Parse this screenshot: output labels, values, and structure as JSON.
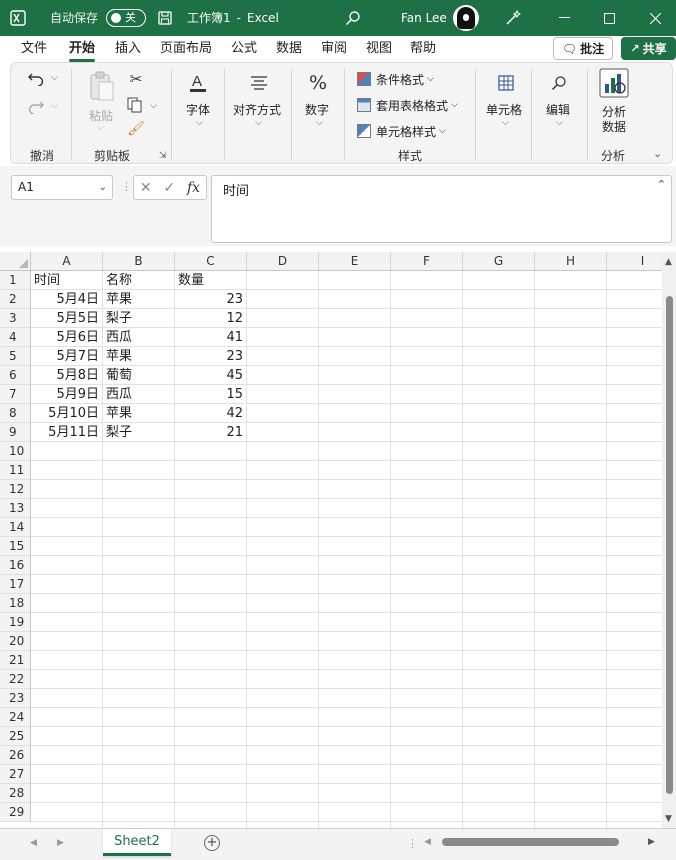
{
  "titlebar": {
    "autosave_label": "自动保存",
    "autosave_state": "关",
    "doc_title": "工作簿1",
    "separator": "-",
    "app_name": "Excel",
    "user_name": "Fan Lee"
  },
  "menu": {
    "items": [
      "文件",
      "开始",
      "插入",
      "页面布局",
      "公式",
      "数据",
      "审阅",
      "视图",
      "帮助"
    ],
    "active": "开始",
    "comment_label": "批注",
    "share_label": "共享"
  },
  "ribbon": {
    "undo_group": "撤消",
    "paste_label": "粘贴",
    "clipboard_group": "剪贴板",
    "font_label": "字体",
    "align_label": "对齐方式",
    "number_label": "数字",
    "cond_format": "条件格式",
    "table_format": "套用表格格式",
    "cell_style": "单元格样式",
    "styles_group": "样式",
    "cells_label": "单元格",
    "edit_label": "编辑",
    "analyze_line1": "分析",
    "analyze_line2": "数据",
    "analyze_group": "分析"
  },
  "formula_bar": {
    "name_box": "A1",
    "content": "时间"
  },
  "grid": {
    "columns": [
      "A",
      "B",
      "C",
      "D",
      "E",
      "F",
      "G",
      "H",
      "I"
    ],
    "row_numbers": [
      "1",
      "2",
      "3",
      "4",
      "5",
      "6",
      "7",
      "8",
      "9",
      "10",
      "11",
      "12",
      "13",
      "14",
      "15",
      "16",
      "17",
      "18",
      "19",
      "20",
      "21",
      "22",
      "23",
      "24",
      "25",
      "26",
      "27",
      "28",
      "29"
    ],
    "headers": [
      "时间",
      "名称",
      "数量"
    ],
    "rows": [
      [
        "5月4日",
        "苹果",
        "23"
      ],
      [
        "5月5日",
        "梨子",
        "12"
      ],
      [
        "5月6日",
        "西瓜",
        "41"
      ],
      [
        "5月7日",
        "苹果",
        "23"
      ],
      [
        "5月8日",
        "葡萄",
        "45"
      ],
      [
        "5月9日",
        "西瓜",
        "15"
      ],
      [
        "5月10日",
        "苹果",
        "42"
      ],
      [
        "5月11日",
        "梨子",
        "21"
      ]
    ]
  },
  "sheets": {
    "active": "Sheet2"
  },
  "colors": {
    "brand": "#1e7145",
    "header_bg": "#f3f3f3",
    "gridline": "#e1e1e1"
  }
}
